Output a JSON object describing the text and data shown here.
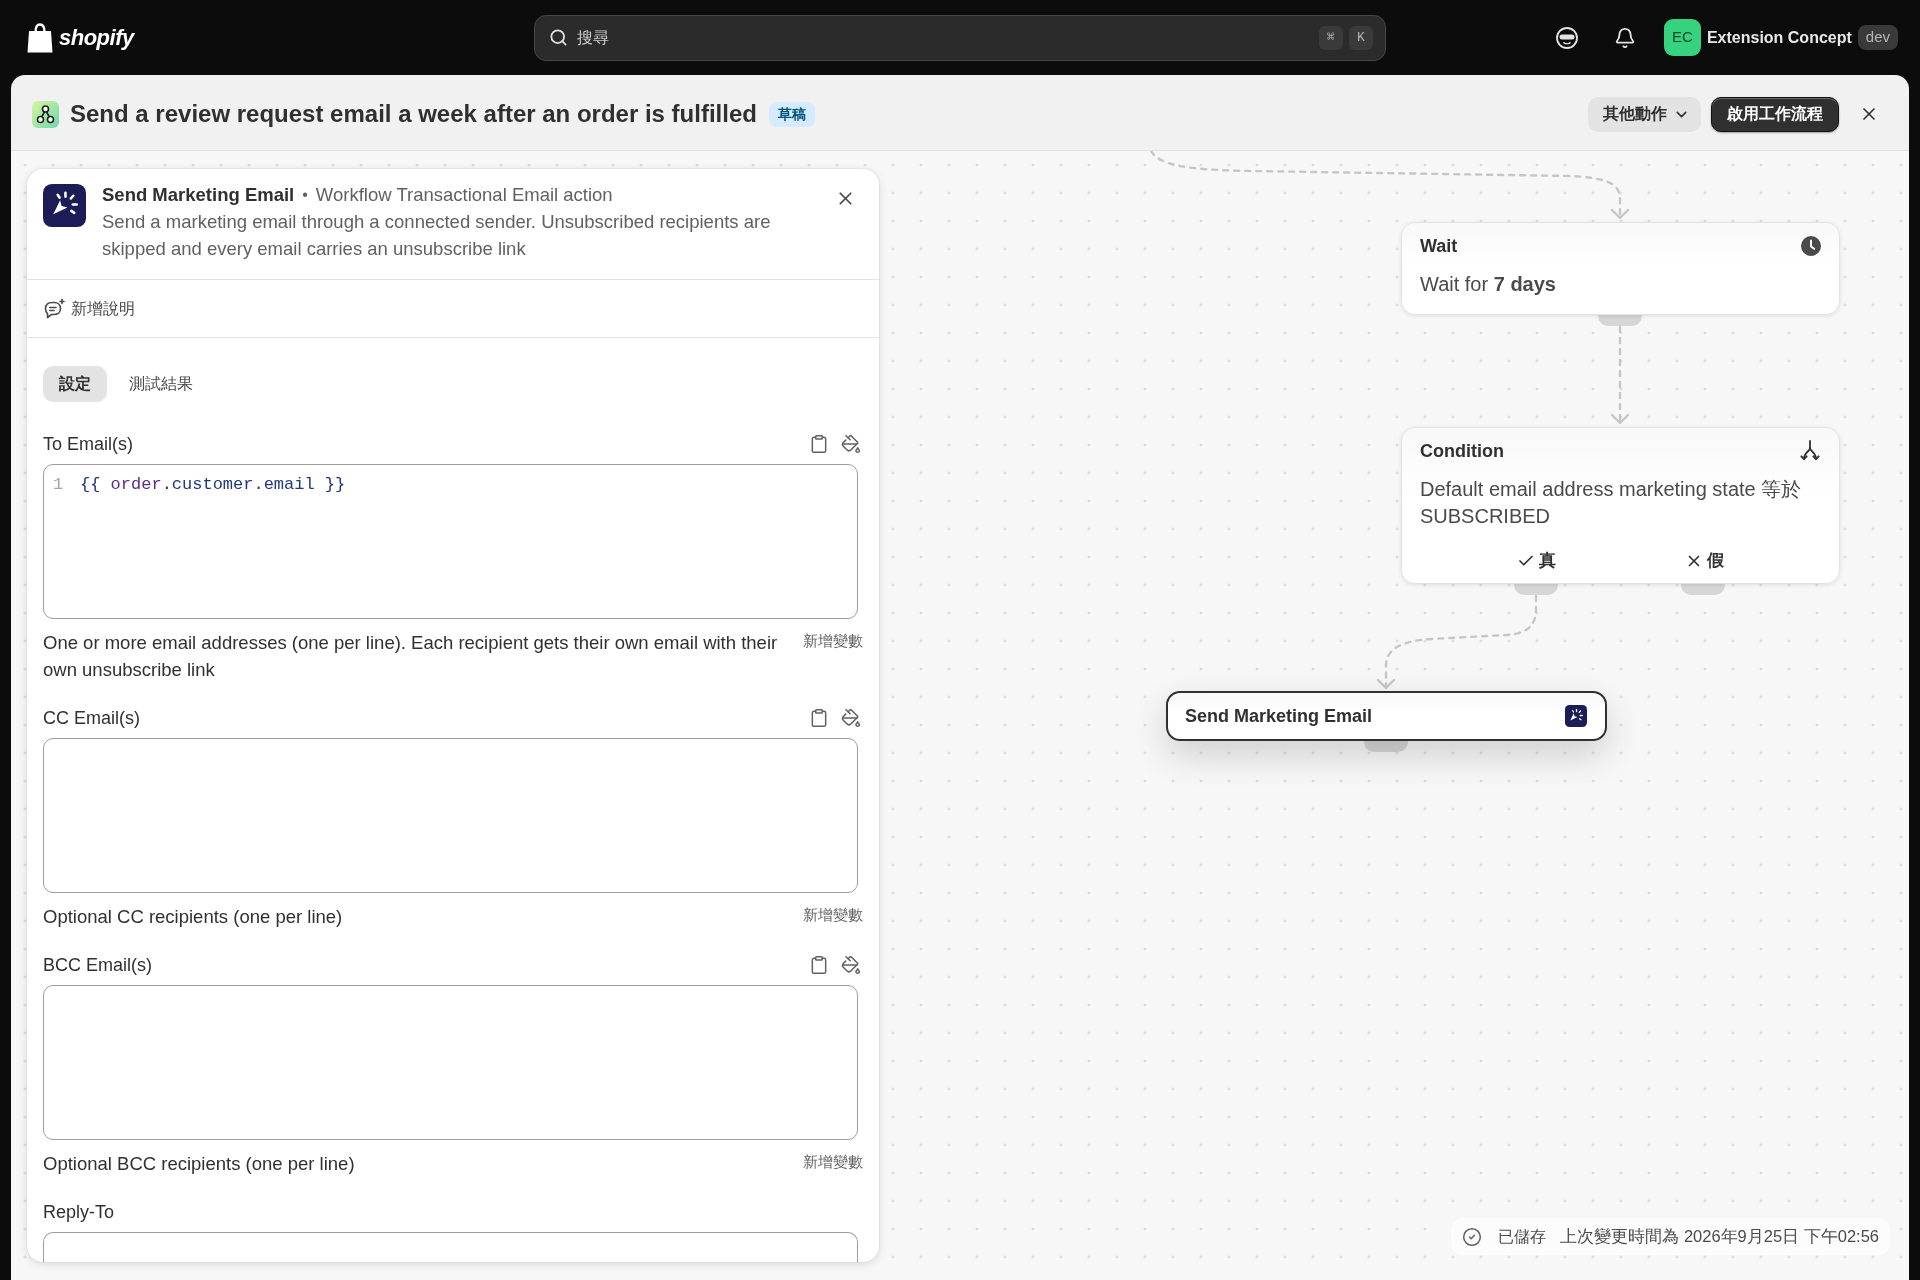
{
  "topbar": {
    "logo": "shopify",
    "search": {
      "placeholder": "搜尋",
      "shortcut": [
        "⌘",
        "K"
      ]
    },
    "account": {
      "initials": "EC",
      "name": "Extension Concept",
      "badge": "dev"
    }
  },
  "workflow": {
    "title": "Send a review request email a week after an order is fulfilled",
    "status": "草稿",
    "actions": [
      {
        "label": "其他動作",
        "kind": "menu"
      },
      {
        "label": "啟用工作流程",
        "kind": "primary"
      }
    ]
  },
  "panel": {
    "title": "Send Marketing Email",
    "separator": "•",
    "subtitle": "Workflow Transactional Email action",
    "description": "Send a marketing email through a connected sender. Unsubscribed recipients are skipped and every email carries an unsubscribe link",
    "add_note": "新增說明",
    "tabs": [
      {
        "label": "設定",
        "selected": true
      },
      {
        "label": "測試結果",
        "selected": false
      }
    ],
    "fields": [
      {
        "label": "To Email(s)",
        "kind": "code",
        "lines": [
          {
            "number": "1",
            "tokens": [
              {
                "text": "{{ ",
                "kind": "delimiter"
              },
              {
                "text": "order",
                "kind": "object"
              },
              {
                "text": ".",
                "kind": "punctuation"
              },
              {
                "text": "customer",
                "kind": "property"
              },
              {
                "text": ".",
                "kind": "punctuation"
              },
              {
                "text": "email",
                "kind": "property"
              },
              {
                "text": " }}",
                "kind": "delimiter"
              }
            ]
          }
        ],
        "help": "One or more email addresses (one per line). Each recipient gets their own email with their own unsubscribe link",
        "insert_variable": "新增變數"
      },
      {
        "label": "CC Email(s)",
        "kind": "textarea",
        "help": "Optional CC recipients (one per line)",
        "insert_variable": "新增變數"
      },
      {
        "label": "BCC Email(s)",
        "kind": "textarea",
        "help": "Optional BCC recipients (one per line)",
        "insert_variable": "新增變數"
      },
      {
        "label": "Reply-To",
        "kind": "input"
      }
    ]
  },
  "canvas": {
    "nodes": [
      {
        "kind": "wait",
        "title": "Wait",
        "text": "Wait for **7 days**",
        "selected": false
      },
      {
        "kind": "condition",
        "title": "Condition",
        "text": "Default email address marketing state 等於 SUBSCRIBED",
        "branches": [
          {
            "kind": "if_true",
            "label": "真"
          },
          {
            "kind": "if_false",
            "label": "假"
          }
        ],
        "selected": false
      },
      {
        "kind": "action",
        "title": "Send Marketing Email",
        "selected": true
      }
    ],
    "save_status": {
      "label": "已儲存",
      "detail": "上次變更時間為 2026年9月25日 下午02:56"
    }
  }
}
